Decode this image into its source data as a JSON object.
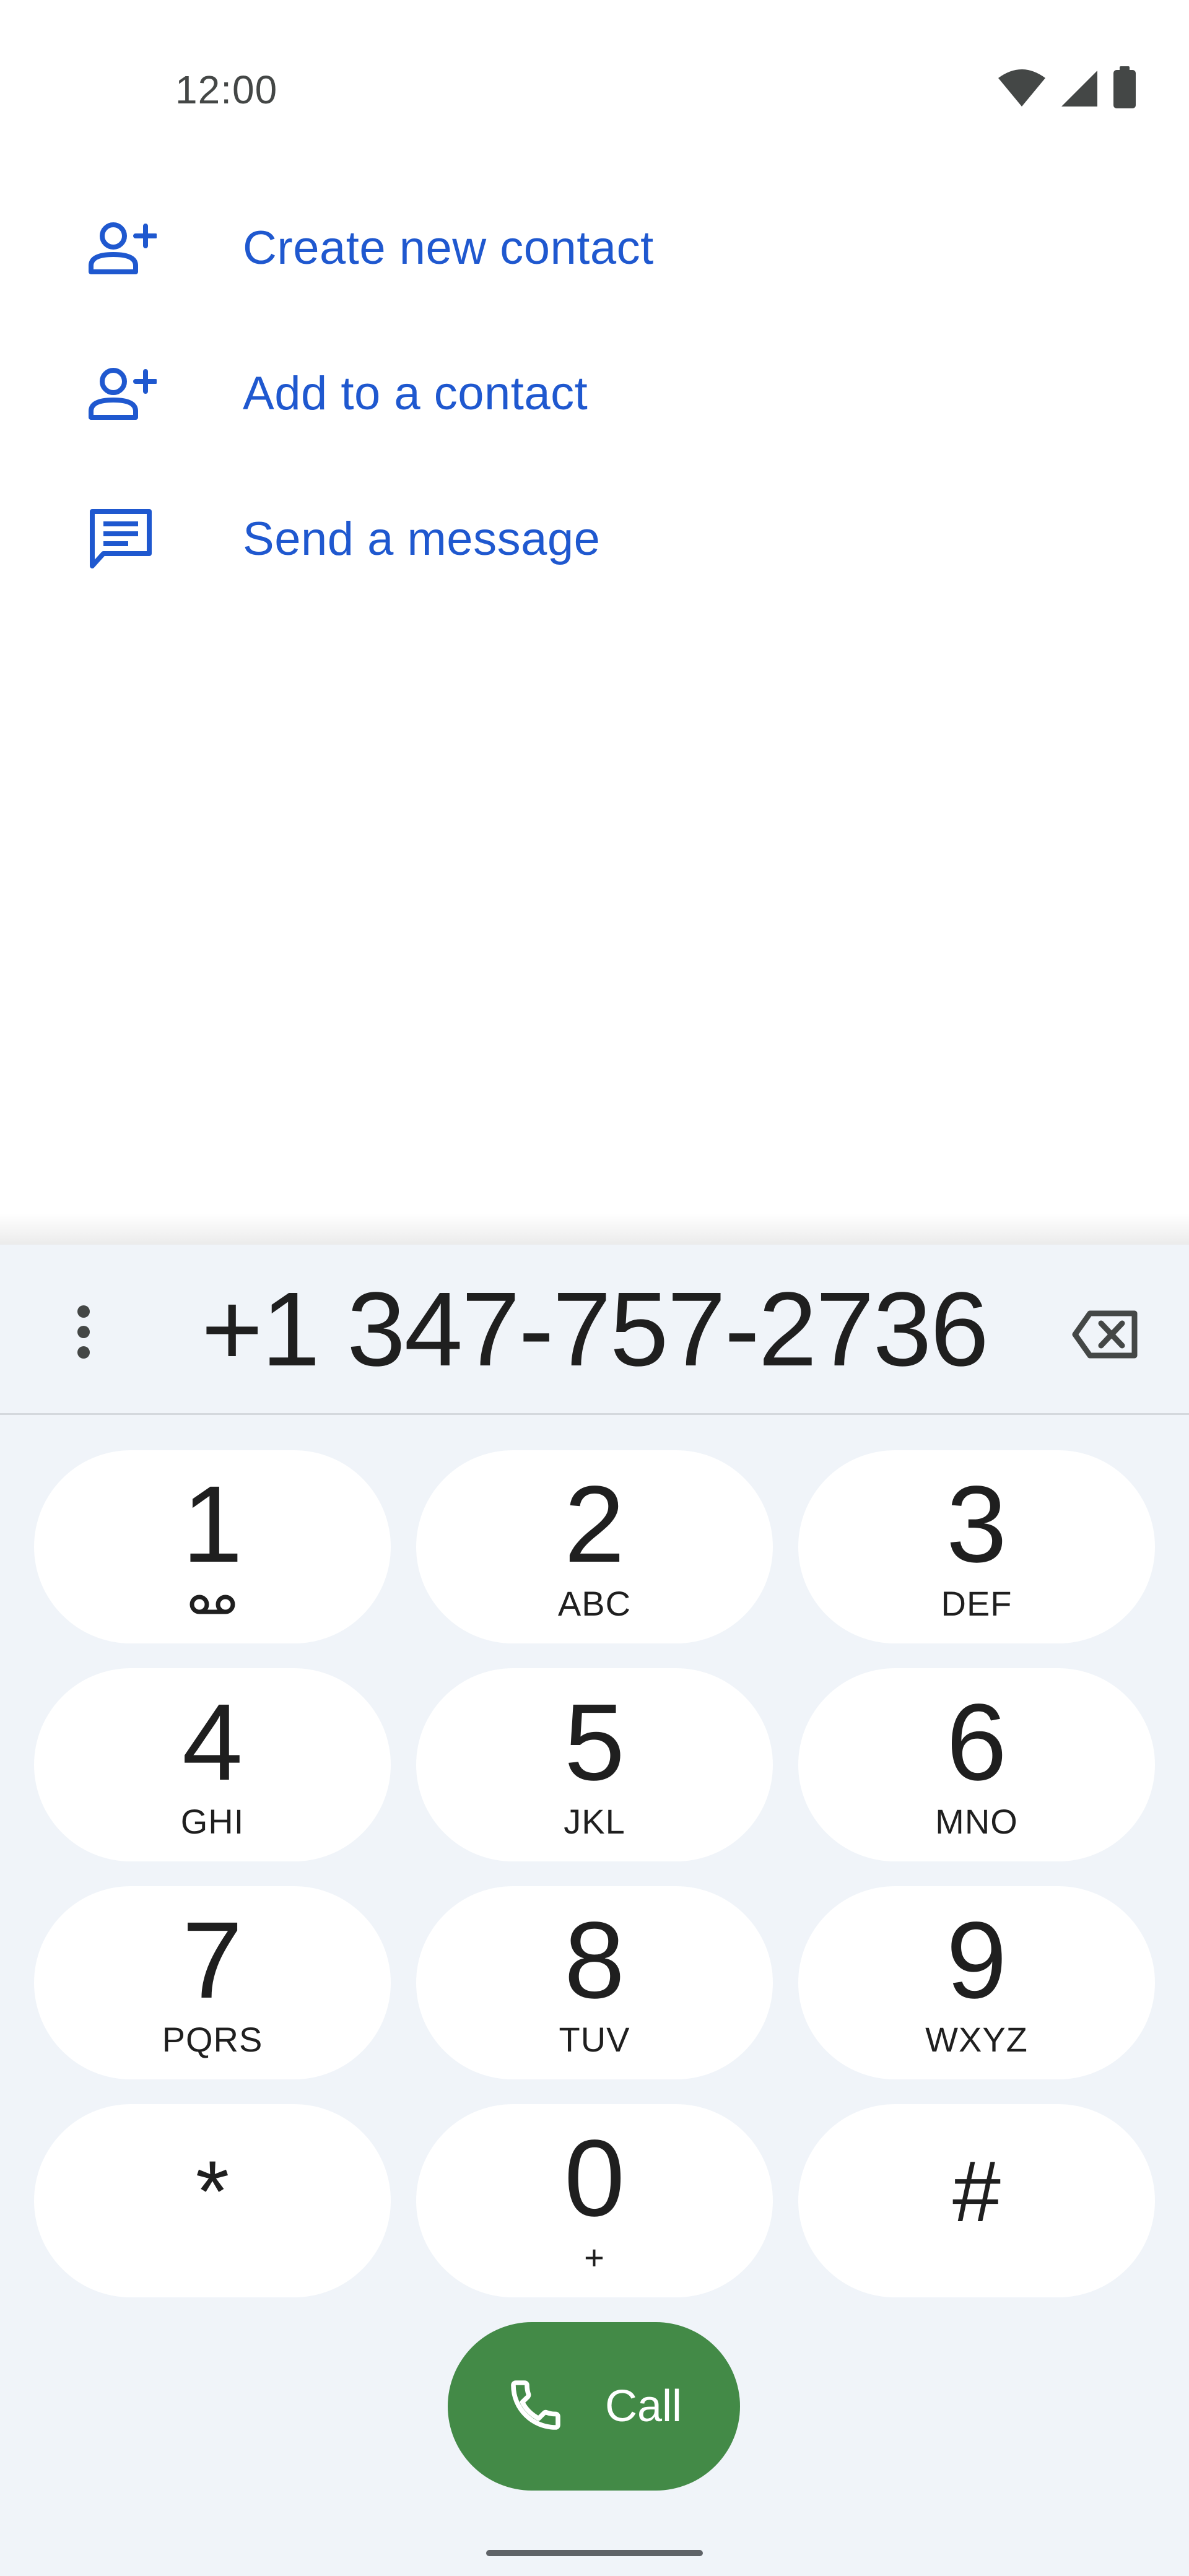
{
  "status_bar": {
    "time": "12:00",
    "icons": [
      "wifi-icon",
      "cell-signal-icon",
      "battery-icon"
    ]
  },
  "actions": [
    {
      "icon": "person-add-icon",
      "label": "Create new contact"
    },
    {
      "icon": "person-add-icon",
      "label": "Add to a contact"
    },
    {
      "icon": "message-icon",
      "label": "Send a message"
    }
  ],
  "dialer": {
    "number": "+1 347-757-2736",
    "overflow_icon": "more-vert-icon",
    "backspace_icon": "backspace-icon"
  },
  "keypad": {
    "keys": [
      {
        "digit": "1",
        "letters": "",
        "extra": "voicemail-icon"
      },
      {
        "digit": "2",
        "letters": "ABC"
      },
      {
        "digit": "3",
        "letters": "DEF"
      },
      {
        "digit": "4",
        "letters": "GHI"
      },
      {
        "digit": "5",
        "letters": "JKL"
      },
      {
        "digit": "6",
        "letters": "MNO"
      },
      {
        "digit": "7",
        "letters": "PQRS"
      },
      {
        "digit": "8",
        "letters": "TUV"
      },
      {
        "digit": "9",
        "letters": "WXYZ"
      },
      {
        "digit": "*",
        "letters": ""
      },
      {
        "digit": "0",
        "letters": "+"
      },
      {
        "digit": "#",
        "letters": ""
      }
    ]
  },
  "call_button": {
    "label": "Call",
    "icon": "phone-icon"
  },
  "colors": {
    "accent_blue": "#1f58cf",
    "call_green": "#438a47",
    "sheet_bg": "#f0f4f9",
    "key_bg": "#ffffff",
    "text": "#1f1f1f"
  }
}
